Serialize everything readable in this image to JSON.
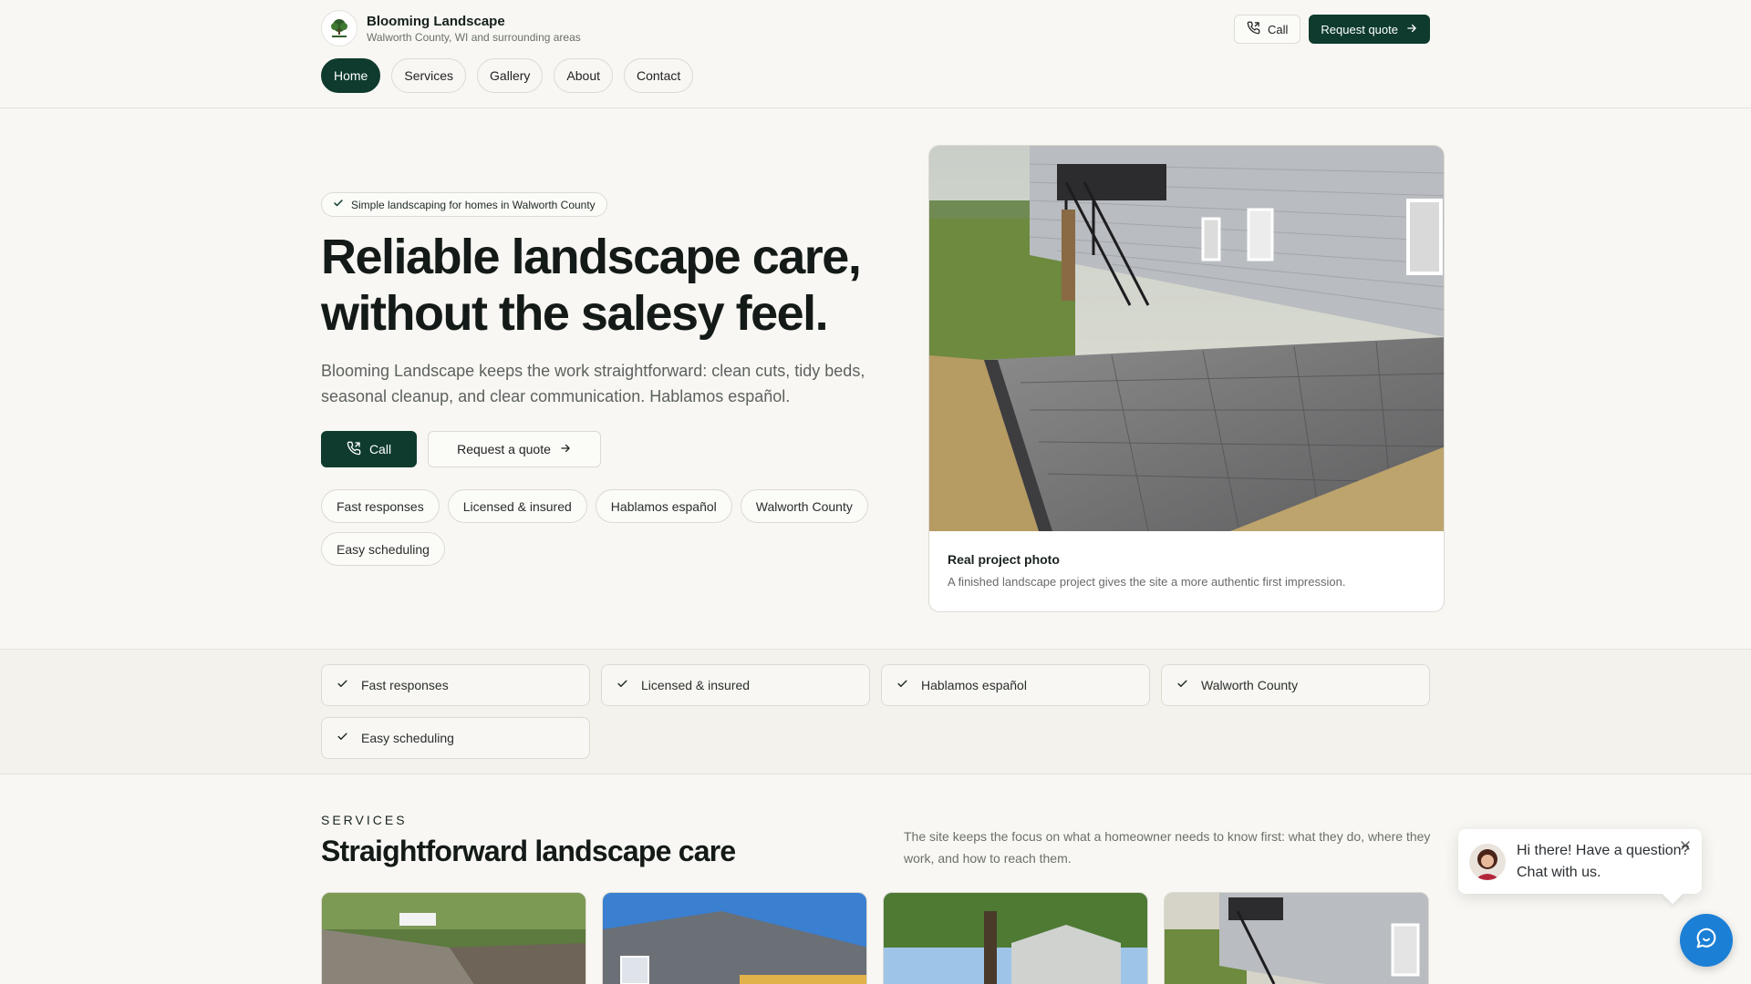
{
  "brand": {
    "name": "Blooming Landscape",
    "tagline": "Walworth County, WI and surrounding areas"
  },
  "header": {
    "call_label": "Call",
    "quote_label": "Request quote"
  },
  "nav": {
    "items": [
      "Home",
      "Services",
      "Gallery",
      "About",
      "Contact"
    ],
    "active": "Home"
  },
  "hero": {
    "badge": "Simple landscaping for homes in Walworth County",
    "title_line1": "Reliable landscape care,",
    "title_line2": "without the salesy feel.",
    "lede": "Blooming Landscape keeps the work straightforward: clean cuts, tidy beds, seasonal cleanup, and clear communication. Hablamos español.",
    "call_label": "Call",
    "quote_label": "Request a quote",
    "chips": [
      "Fast responses",
      "Licensed & insured",
      "Hablamos español",
      "Walworth County",
      "Easy scheduling"
    ],
    "photo_caption_title": "Real project photo",
    "photo_caption_text": "A finished landscape project gives the site a more authentic first impression."
  },
  "features": [
    "Fast responses",
    "Licensed & insured",
    "Hablamos español",
    "Walworth County",
    "Easy scheduling"
  ],
  "services": {
    "eyebrow": "SERVICES",
    "title": "Straightforward landscape care",
    "note": "The site keeps the focus on what a homeowner needs to know first: what they do, where they work, and how to reach them."
  },
  "chat": {
    "line1": "Hi there! Have a question?",
    "line2": "Chat with us."
  },
  "colors": {
    "brand_green": "#0e3b2e",
    "page_bg": "#f8f7f3",
    "chat_blue": "#1b7fd6"
  }
}
